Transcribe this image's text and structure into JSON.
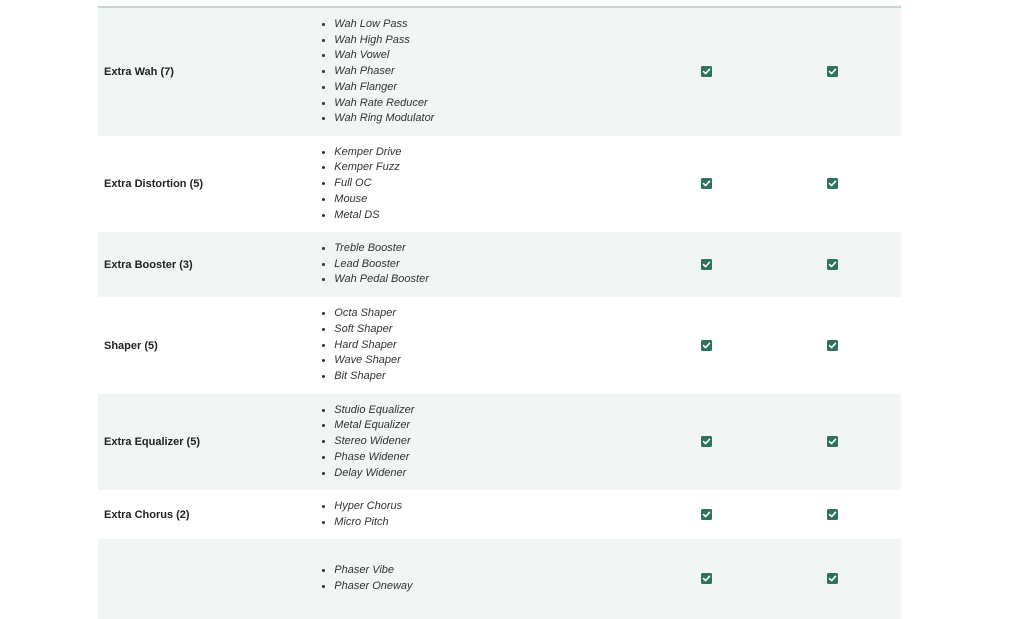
{
  "colors": {
    "row_alt_bg": "#f1f5f4",
    "row_bg": "#ffffff",
    "header_border": "#bcd8cf",
    "checkbox": "#2f7459"
  },
  "rows": [
    {
      "name": "Extra Wah (7)",
      "effects": [
        "Wah Low Pass",
        "Wah High Pass",
        "Wah Vowel",
        "Wah Phaser",
        "Wah Flanger",
        "Wah Rate Reducer",
        "Wah Ring Modulator"
      ],
      "col1_checked": true,
      "col2_checked": true
    },
    {
      "name": "Extra Distortion (5)",
      "effects": [
        "Kemper Drive",
        "Kemper Fuzz",
        "Full OC",
        "Mouse",
        "Metal DS"
      ],
      "col1_checked": true,
      "col2_checked": true
    },
    {
      "name": "Extra Booster (3)",
      "effects": [
        "Treble Booster",
        "Lead Booster",
        "Wah Pedal Booster"
      ],
      "col1_checked": true,
      "col2_checked": true
    },
    {
      "name": "Shaper (5)",
      "effects": [
        "Octa Shaper",
        "Soft Shaper",
        "Hard Shaper",
        "Wave Shaper",
        "Bit Shaper"
      ],
      "col1_checked": true,
      "col2_checked": true
    },
    {
      "name": "Extra Equalizer (5)",
      "effects": [
        "Studio Equalizer",
        "Metal Equalizer",
        "Stereo Widener",
        "Phase Widener",
        "Delay Widener"
      ],
      "col1_checked": true,
      "col2_checked": true
    },
    {
      "name": "Extra Chorus (2)",
      "effects": [
        "Hyper Chorus",
        "Micro Pitch"
      ],
      "col1_checked": true,
      "col2_checked": true
    },
    {
      "name": "",
      "effects": [
        "Phaser Vibe",
        "Phaser Oneway"
      ],
      "col1_checked": true,
      "col2_checked": true
    }
  ]
}
